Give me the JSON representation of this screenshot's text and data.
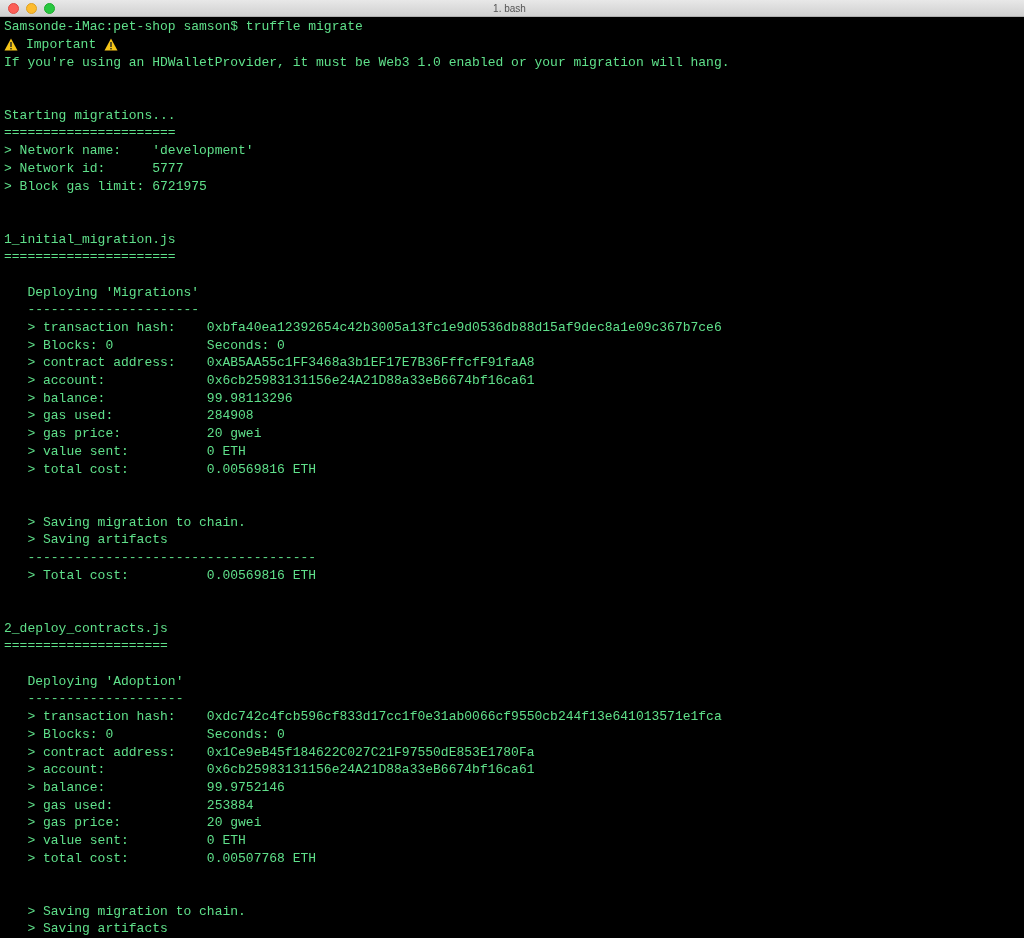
{
  "window": {
    "title": "1. bash"
  },
  "lines": [
    {
      "kind": "text",
      "text": "Samsonde-iMac:pet-shop samson$ truffle migrate"
    },
    {
      "kind": "warning",
      "text": "Important"
    },
    {
      "kind": "text",
      "text": "If you're using an HDWalletProvider, it must be Web3 1.0 enabled or your migration will hang."
    },
    {
      "kind": "blank"
    },
    {
      "kind": "blank"
    },
    {
      "kind": "text",
      "text": "Starting migrations..."
    },
    {
      "kind": "text",
      "text": "======================"
    },
    {
      "kind": "text",
      "text": "> Network name:    'development'"
    },
    {
      "kind": "text",
      "text": "> Network id:      5777"
    },
    {
      "kind": "text",
      "text": "> Block gas limit: 6721975"
    },
    {
      "kind": "blank"
    },
    {
      "kind": "blank"
    },
    {
      "kind": "text",
      "text": "1_initial_migration.js"
    },
    {
      "kind": "text",
      "text": "======================"
    },
    {
      "kind": "blank"
    },
    {
      "kind": "text",
      "text": "   Deploying 'Migrations'"
    },
    {
      "kind": "text",
      "text": "   ----------------------"
    },
    {
      "kind": "text",
      "text": "   > transaction hash:    0xbfa40ea12392654c42b3005a13fc1e9d0536db88d15af9dec8a1e09c367b7ce6"
    },
    {
      "kind": "text",
      "text": "   > Blocks: 0            Seconds: 0"
    },
    {
      "kind": "text",
      "text": "   > contract address:    0xAB5AA55c1FF3468a3b1EF17E7B36FffcfF91faA8"
    },
    {
      "kind": "text",
      "text": "   > account:             0x6cb25983131156e24A21D88a33eB6674bf16ca61"
    },
    {
      "kind": "text",
      "text": "   > balance:             99.98113296"
    },
    {
      "kind": "text",
      "text": "   > gas used:            284908"
    },
    {
      "kind": "text",
      "text": "   > gas price:           20 gwei"
    },
    {
      "kind": "text",
      "text": "   > value sent:          0 ETH"
    },
    {
      "kind": "text",
      "text": "   > total cost:          0.00569816 ETH"
    },
    {
      "kind": "blank"
    },
    {
      "kind": "blank"
    },
    {
      "kind": "text",
      "text": "   > Saving migration to chain."
    },
    {
      "kind": "text",
      "text": "   > Saving artifacts"
    },
    {
      "kind": "text",
      "text": "   -------------------------------------"
    },
    {
      "kind": "text",
      "text": "   > Total cost:          0.00569816 ETH"
    },
    {
      "kind": "blank"
    },
    {
      "kind": "blank"
    },
    {
      "kind": "text",
      "text": "2_deploy_contracts.js"
    },
    {
      "kind": "text",
      "text": "====================="
    },
    {
      "kind": "blank"
    },
    {
      "kind": "text",
      "text": "   Deploying 'Adoption'"
    },
    {
      "kind": "text",
      "text": "   --------------------"
    },
    {
      "kind": "text",
      "text": "   > transaction hash:    0xdc742c4fcb596cf833d17cc1f0e31ab0066cf9550cb244f13e641013571e1fca"
    },
    {
      "kind": "text",
      "text": "   > Blocks: 0            Seconds: 0"
    },
    {
      "kind": "text",
      "text": "   > contract address:    0x1Ce9eB45f184622C027C21F97550dE853E1780Fa"
    },
    {
      "kind": "text",
      "text": "   > account:             0x6cb25983131156e24A21D88a33eB6674bf16ca61"
    },
    {
      "kind": "text",
      "text": "   > balance:             99.9752146"
    },
    {
      "kind": "text",
      "text": "   > gas used:            253884"
    },
    {
      "kind": "text",
      "text": "   > gas price:           20 gwei"
    },
    {
      "kind": "text",
      "text": "   > value sent:          0 ETH"
    },
    {
      "kind": "text",
      "text": "   > total cost:          0.00507768 ETH"
    },
    {
      "kind": "blank"
    },
    {
      "kind": "blank"
    },
    {
      "kind": "text",
      "text": "   > Saving migration to chain."
    },
    {
      "kind": "text",
      "text": "   > Saving artifacts"
    }
  ]
}
